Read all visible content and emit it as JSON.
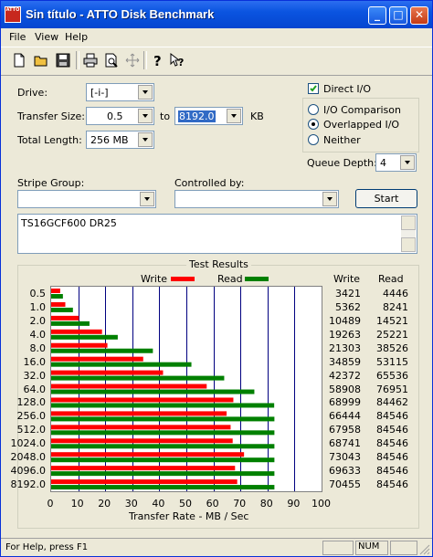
{
  "window": {
    "title": "Sin título - ATTO Disk Benchmark",
    "icon_text": "ATTO",
    "controls": [
      "minimize-icon",
      "maximize-icon",
      "close-icon"
    ]
  },
  "menu": {
    "items": [
      "File",
      "View",
      "Help"
    ]
  },
  "toolbar": {
    "icons": [
      "new-document-icon",
      "open-folder-icon",
      "save-icon",
      "print-icon",
      "print-preview-icon",
      "move-icon",
      "help-icon",
      "context-help-icon"
    ]
  },
  "form": {
    "drive_label": "Drive:",
    "drive_value": "[-i-]",
    "transfer_size_label": "Transfer Size:",
    "transfer_from": "0.5",
    "to_label": "to",
    "transfer_to": "8192.0",
    "kb_label": "KB",
    "total_length_label": "Total Length:",
    "total_length_value": "256 MB",
    "direct_io_label": "Direct I/O",
    "io_comparison_label": "I/O Comparison",
    "overlapped_io_label": "Overlapped I/O",
    "neither_label": "Neither",
    "queue_depth_label": "Queue Depth:",
    "queue_depth_value": "4",
    "stripe_group_label": "Stripe Group:",
    "stripe_group_value": "",
    "controlled_by_label": "Controlled by:",
    "controlled_by_value": "",
    "start_label": "Start",
    "description_text": "TS16GCF600 DR25"
  },
  "results": {
    "group_label": "Test Results",
    "write_legend": "Write",
    "read_legend": "Read",
    "write_col": "Write",
    "read_col": "Read",
    "write_color": "#ff0000",
    "read_color": "#008000"
  },
  "chart_data": {
    "type": "bar",
    "orientation": "horizontal",
    "categories": [
      "0.5",
      "1.0",
      "2.0",
      "4.0",
      "8.0",
      "16.0",
      "32.0",
      "64.0",
      "128.0",
      "256.0",
      "512.0",
      "1024.0",
      "2048.0",
      "4096.0",
      "8192.0"
    ],
    "series": [
      {
        "name": "Write",
        "values": [
          3421,
          5362,
          10489,
          19263,
          21303,
          34859,
          42372,
          58908,
          68999,
          66444,
          67958,
          68741,
          73043,
          69633,
          70455
        ]
      },
      {
        "name": "Read",
        "values": [
          4446,
          8241,
          14521,
          25221,
          38526,
          53115,
          65536,
          76951,
          84462,
          84546,
          84546,
          84546,
          84546,
          84546,
          84546
        ]
      }
    ],
    "xlabel": "Transfer Rate - MB / Sec",
    "xticks": [
      "0",
      "10",
      "20",
      "30",
      "40",
      "50",
      "60",
      "70",
      "80",
      "90",
      "100"
    ],
    "xlim": [
      0,
      100
    ],
    "grid": true,
    "legend": "top"
  },
  "statusbar": {
    "help_text": "For Help, press F1",
    "num_text": "NUM"
  }
}
